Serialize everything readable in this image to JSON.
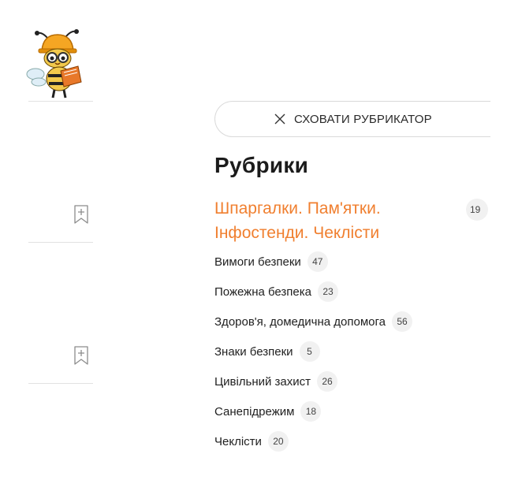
{
  "hide_button": {
    "label": "СХОВАТИ РУБРИКАТОР",
    "icon": "close-icon"
  },
  "heading": "Рубрики",
  "featured_category": {
    "label": "Шпаргалки. Пам'ятки. Інфостенди. Чеклісти",
    "count": "19"
  },
  "categories": [
    {
      "label": "Вимоги безпеки",
      "count": "47"
    },
    {
      "label": "Пожежна безпека",
      "count": "23"
    },
    {
      "label": "Здоров'я, домедична допомога",
      "count": "56"
    },
    {
      "label": "Знаки безпеки",
      "count": "5"
    },
    {
      "label": "Цивільний захист",
      "count": "26"
    },
    {
      "label": "Санепідрежим",
      "count": "18"
    },
    {
      "label": "Чеклісти",
      "count": "20"
    }
  ],
  "left_strip": {
    "mascot": "bee-mascot-with-hard-hat-reading-book",
    "bookmark_icon": "bookmark-add-icon"
  },
  "colors": {
    "accent": "#f07f2f",
    "text": "#1f1f1f",
    "badge_bg": "#f1f1f1",
    "border": "#d9d9d9"
  }
}
